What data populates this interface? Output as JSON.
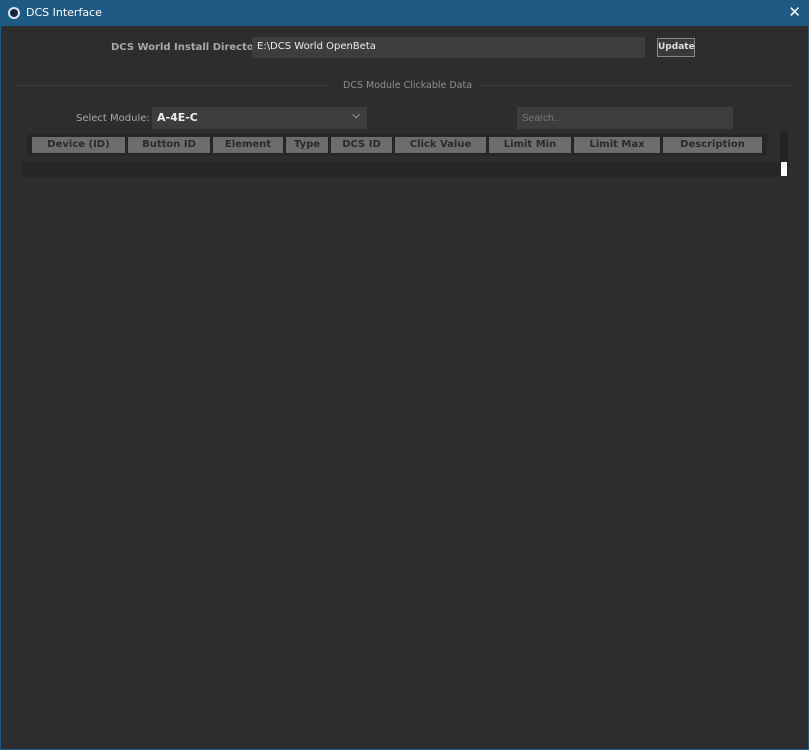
{
  "window": {
    "title": "DCS Interface"
  },
  "install": {
    "label": "DCS World Install Directory:",
    "value": "E:\\DCS World OpenBeta",
    "update_label": "Update"
  },
  "section": {
    "title": "DCS Module Clickable Data"
  },
  "module": {
    "label": "Select Module:",
    "selected": "A-4E-C"
  },
  "search": {
    "placeholder": "Search.."
  },
  "table": {
    "columns": [
      "Device (ID)",
      "Button ID",
      "Element",
      "Type",
      "DCS ID",
      "Click Value",
      "Limit Min",
      "Limit Max",
      "Description"
    ]
  }
}
